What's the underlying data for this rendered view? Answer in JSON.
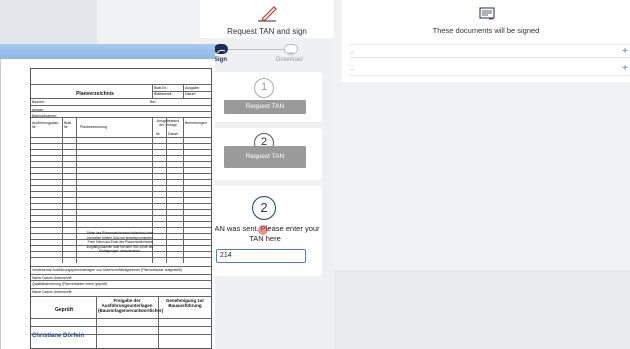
{
  "signing": {
    "title": "Request TAN and sign",
    "steps": [
      {
        "label": "Sign"
      },
      {
        "label": "Download"
      }
    ],
    "card1": {
      "number": "1",
      "button": "Request TAN"
    },
    "card2": {
      "number": "2",
      "button": "Request TAN"
    },
    "card3": {
      "number": "2",
      "message": "TAN was sent. Please enter your TAN here",
      "input_value": "214"
    }
  },
  "documents": {
    "title": "These documents will be signed",
    "rows": [
      {
        "name": "..",
        "action": "+"
      },
      {
        "name": "..",
        "action": "+"
      }
    ]
  },
  "pdf": {
    "title": "Planverzeichnis",
    "header_cells": [
      "Blatt-Nr.:",
      "Ausgabe:",
      "Blattanzahl:",
      "Datum:"
    ],
    "fields": [
      "Bauherr:",
      "Bauteil:",
      "Anlage:",
      "Baumaßnahme:",
      "Ber.:"
    ],
    "columns": [
      "Ausführungsplan-Nr.",
      "Blatt Nr.",
      "Planbezeichnung",
      "Ausgabestand der Vorlage",
      "Bemerkungen",
      "Nr.",
      "Datum"
    ],
    "note": "Zeilen des Planverzeichnisses fortlaufend ohne Leerzeilen führen! Sind nur einseitig unmerken. Freie Zeilen am Ende des Planverzeichnisses sorgfältig kaschen oder mit dem Text „Ende der Eintragungen\" kennzeichnen.",
    "bottom_lines": [
      "Vorstehende Ausführungsplanunterlagen von Unterschriftsträgerinnen (Planverfasser aufgestellt)",
      "Name                Datum                Unterschrift",
      "Qualitätssicherung (Planverfasser intern geprüft)",
      "Name                Datum                Unterschrift"
    ],
    "geprueft": "Geprüft",
    "freigabe": "Freigabe der Ausführungsunterlagen (Bauvorlagenverantwortlicher)",
    "genehmigung": "Genehmigung zur Bauausführung",
    "signer": "Christiane Dörfein"
  },
  "colors": {
    "accent": "#1e2c5a",
    "input_border": "#4a7fc8",
    "button_gray": "#9a9a9a",
    "viewer_bar": "#8fb7e6"
  },
  "icons": [
    "pen-icon",
    "document-icon",
    "cloud-download-icon"
  ]
}
